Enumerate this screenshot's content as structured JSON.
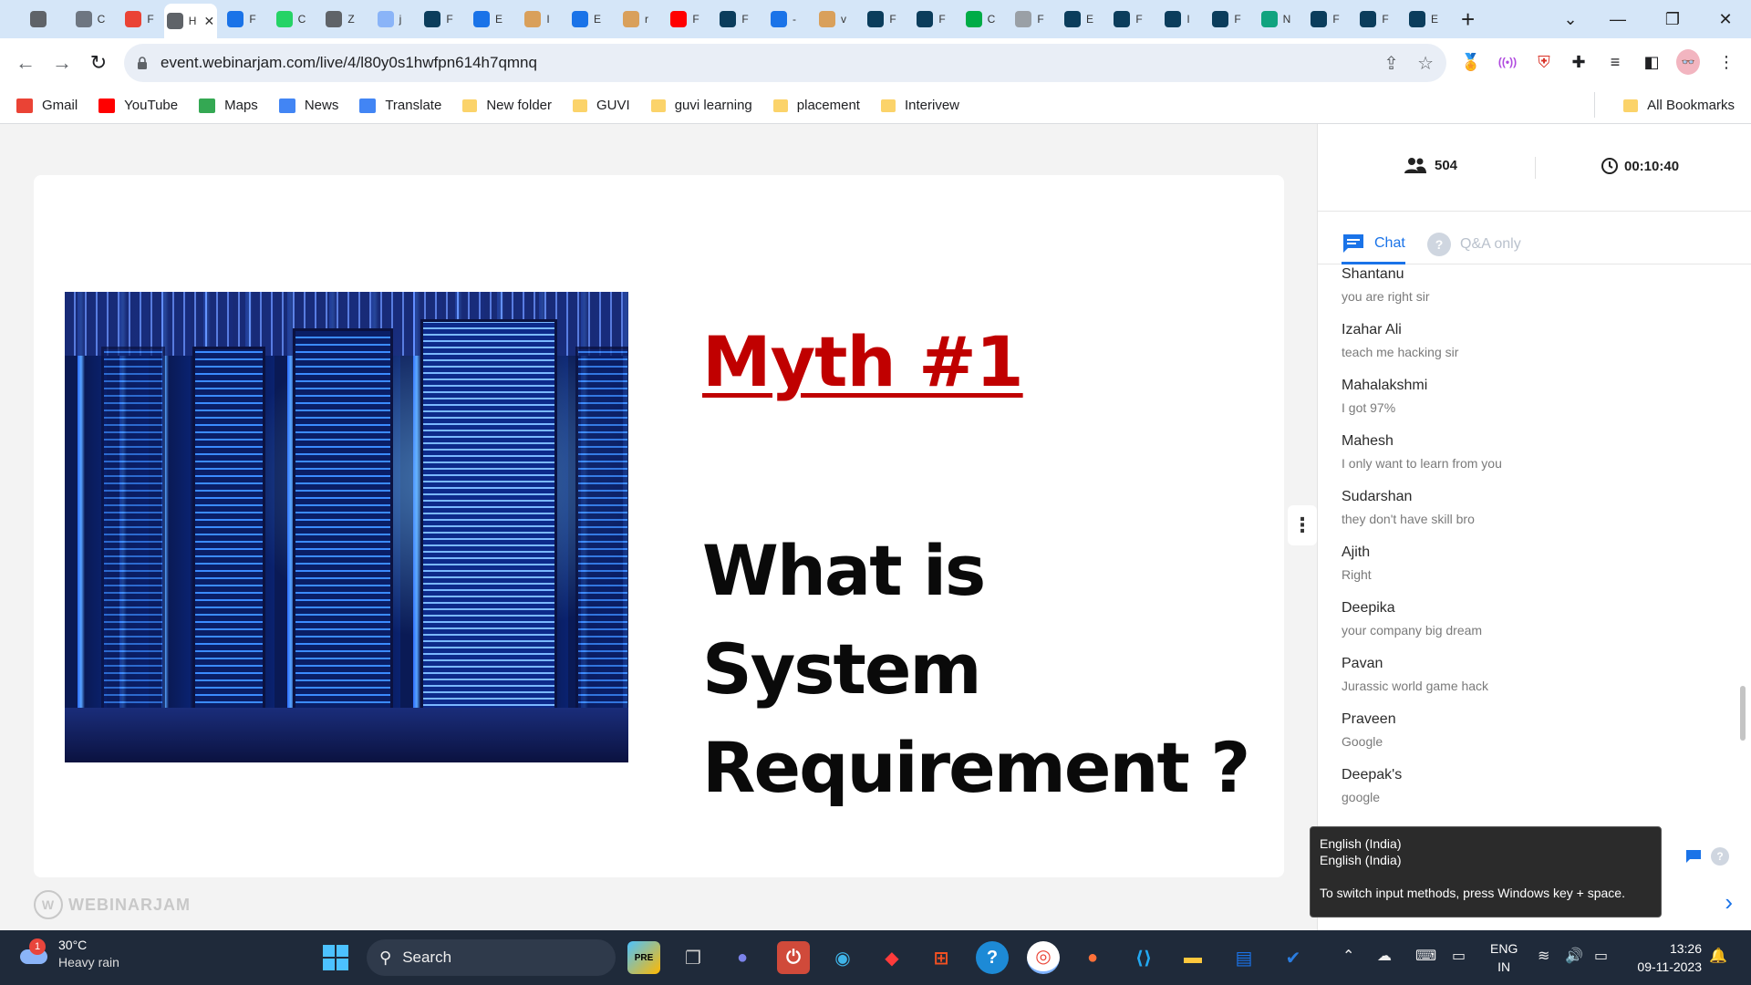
{
  "browser": {
    "tabs": [
      {
        "icon": "circle-icon",
        "color": "#5f6368",
        "title": ""
      },
      {
        "icon": "github-icon",
        "color": "#6e7681",
        "title": "C"
      },
      {
        "icon": "gmail-icon",
        "color": "#ea4335",
        "title": "F"
      },
      {
        "icon": "page-icon",
        "color": "#5f6368",
        "title": "H",
        "active": true
      },
      {
        "icon": "zoho-icon",
        "color": "#1a73e8",
        "title": "F"
      },
      {
        "icon": "whatsapp-icon",
        "color": "#25d366",
        "title": "C"
      },
      {
        "icon": "doc-icon",
        "color": "#5f6368",
        "title": "Z"
      },
      {
        "icon": "github-icon",
        "color": "#8ab4f8",
        "title": "j"
      },
      {
        "icon": "react-icon",
        "color": "#0b3d5c",
        "title": "F"
      },
      {
        "icon": "search-icon",
        "color": "#1a73e8",
        "title": "E"
      },
      {
        "icon": "hand-icon",
        "color": "#d9a05b",
        "title": "I"
      },
      {
        "icon": "search-icon",
        "color": "#1a73e8",
        "title": "E"
      },
      {
        "icon": "hand-icon",
        "color": "#d9a05b",
        "title": "r"
      },
      {
        "icon": "youtube-icon",
        "color": "#ff0000",
        "title": "F"
      },
      {
        "icon": "react-icon",
        "color": "#0b3d5c",
        "title": "F"
      },
      {
        "icon": "search-icon",
        "color": "#1a73e8",
        "title": "-"
      },
      {
        "icon": "hand-icon",
        "color": "#d9a05b",
        "title": "v"
      },
      {
        "icon": "react-icon",
        "color": "#0b3d5c",
        "title": "F"
      },
      {
        "icon": "react-icon",
        "color": "#0b3d5c",
        "title": "F"
      },
      {
        "icon": "meet-icon",
        "color": "#00ac47",
        "title": "C"
      },
      {
        "icon": "globe-icon",
        "color": "#9aa0a6",
        "title": "F"
      },
      {
        "icon": "react-icon",
        "color": "#0b3d5c",
        "title": "E"
      },
      {
        "icon": "react-icon",
        "color": "#0b3d5c",
        "title": "F"
      },
      {
        "icon": "react-icon",
        "color": "#0b3d5c",
        "title": "I"
      },
      {
        "icon": "react-icon",
        "color": "#0b3d5c",
        "title": "F"
      },
      {
        "icon": "hex-icon",
        "color": "#10a37f",
        "title": "N"
      },
      {
        "icon": "react-icon",
        "color": "#0b3d5c",
        "title": "F"
      },
      {
        "icon": "react-icon",
        "color": "#0b3d5c",
        "title": "F"
      },
      {
        "icon": "react-icon",
        "color": "#0b3d5c",
        "title": "E"
      }
    ],
    "url": "event.webinarjam.com/live/4/l80y0s1hwfpn614h7qmnq",
    "bookmarks": [
      {
        "label": "Gmail",
        "icon": "gmail-icon",
        "color": "#ea4335"
      },
      {
        "label": "YouTube",
        "icon": "youtube-icon",
        "color": "#ff0000"
      },
      {
        "label": "Maps",
        "icon": "maps-icon",
        "color": "#34a853"
      },
      {
        "label": "News",
        "icon": "news-icon",
        "color": "#4285f4"
      },
      {
        "label": "Translate",
        "icon": "translate-icon",
        "color": "#4285f4"
      },
      {
        "label": "New folder",
        "icon": "folder-icon",
        "color": "#fbd36a"
      },
      {
        "label": "GUVI",
        "icon": "folder-icon",
        "color": "#fbd36a"
      },
      {
        "label": "guvi learning",
        "icon": "folder-icon",
        "color": "#fbd36a"
      },
      {
        "label": "placement",
        "icon": "folder-icon",
        "color": "#fbd36a"
      },
      {
        "label": "Interivew",
        "icon": "folder-icon",
        "color": "#fbd36a"
      }
    ],
    "all_bookmarks": "All Bookmarks"
  },
  "slide": {
    "title": "Myth #1",
    "question": "What is System Requirement ?",
    "title_color": "#c00000"
  },
  "logo": "WEBINARJAM",
  "panel": {
    "attendees": "504",
    "timer": "00:10:40",
    "tab_chat": "Chat",
    "tab_qa": "Q&A only",
    "qa_badge": "?",
    "accent": "#1a73e8",
    "messages": [
      {
        "name": "Shantanu",
        "text": "you are right sir"
      },
      {
        "name": "Izahar Ali",
        "text": "teach me hacking sir"
      },
      {
        "name": "Mahalakshmi",
        "text": "I got 97%"
      },
      {
        "name": "Mahesh",
        "text": "I only want to learn from you"
      },
      {
        "name": "Sudarshan",
        "text": "they don't have skill bro"
      },
      {
        "name": "Ajith",
        "text": "Right"
      },
      {
        "name": "Deepika",
        "text": "your company big dream"
      },
      {
        "name": "Pavan",
        "text": "Jurassic world game hack"
      },
      {
        "name": "Praveen",
        "text": "Google"
      },
      {
        "name": "Deepak's",
        "text": "google"
      }
    ]
  },
  "tooltip": {
    "line1": "English (India)",
    "line2": "English (India)",
    "hint": "To switch input methods, press Windows key + space."
  },
  "taskbar": {
    "weather_badge": "1",
    "temperature": "30°C",
    "weather": "Heavy rain",
    "search_placeholder": "Search",
    "lang_top": "ENG",
    "lang_bottom": "IN",
    "time": "13:26",
    "date": "09-11-2023"
  }
}
